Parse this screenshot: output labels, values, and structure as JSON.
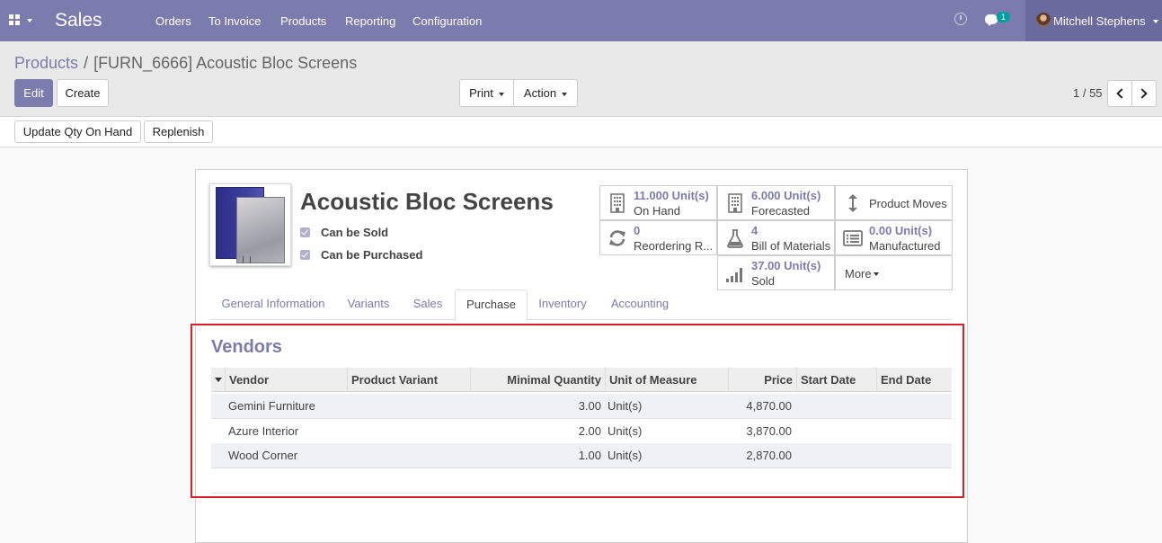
{
  "navbar": {
    "brand": "Sales",
    "menu": [
      "Orders",
      "To Invoice",
      "Products",
      "Reporting",
      "Configuration"
    ],
    "chat_badge": "1",
    "user_name": "Mitchell Stephens"
  },
  "breadcrumb": {
    "parent": "Products",
    "separator": "/",
    "current": "[FURN_6666] Acoustic Bloc Screens"
  },
  "buttons": {
    "edit": "Edit",
    "create": "Create",
    "print": "Print",
    "action": "Action",
    "update_qty": "Update Qty On Hand",
    "replenish": "Replenish"
  },
  "pager": {
    "value": "1 / 55"
  },
  "product": {
    "name": "Acoustic Bloc Screens",
    "can_be_sold": "Can be Sold",
    "can_be_purchased": "Can be Purchased"
  },
  "smart_buttons": {
    "on_hand": {
      "value": "11.000 Unit(s)",
      "label": "On Hand",
      "icon": "building-icon"
    },
    "forecasted": {
      "value": "6.000 Unit(s)",
      "label": "Forecasted",
      "icon": "building-icon"
    },
    "product_moves": {
      "label": "Product Moves",
      "icon": "updown-arrow-icon"
    },
    "reordering": {
      "value": "0",
      "label": "Reordering R...",
      "icon": "refresh-icon"
    },
    "bom": {
      "value": "4",
      "label": "Bill of Materials",
      "icon": "flask-icon"
    },
    "manufactured": {
      "value": "0.00 Unit(s)",
      "label": "Manufactured",
      "icon": "list-alt-icon"
    },
    "sold": {
      "value": "37.00 Unit(s)",
      "label": "Sold",
      "icon": "signal-icon"
    },
    "more": "More"
  },
  "tabs": [
    "General Information",
    "Variants",
    "Sales",
    "Purchase",
    "Inventory",
    "Accounting"
  ],
  "active_tab": "Purchase",
  "vendors": {
    "title": "Vendors",
    "columns": [
      "Vendor",
      "Product Variant",
      "Minimal Quantity",
      "Unit of Measure",
      "Price",
      "Start Date",
      "End Date"
    ],
    "rows": [
      {
        "vendor": "Gemini Furniture",
        "variant": "",
        "min_qty": "3.00",
        "uom": "Unit(s)",
        "price": "4,870.00",
        "start": "",
        "end": ""
      },
      {
        "vendor": "Azure Interior",
        "variant": "",
        "min_qty": "2.00",
        "uom": "Unit(s)",
        "price": "3,870.00",
        "start": "",
        "end": ""
      },
      {
        "vendor": "Wood Corner",
        "variant": "",
        "min_qty": "1.00",
        "uom": "Unit(s)",
        "price": "2,870.00",
        "start": "",
        "end": ""
      }
    ]
  },
  "colors": {
    "brand": "#7c7bad",
    "highlight_border": "#d9202b",
    "badge": "#00a09d"
  }
}
